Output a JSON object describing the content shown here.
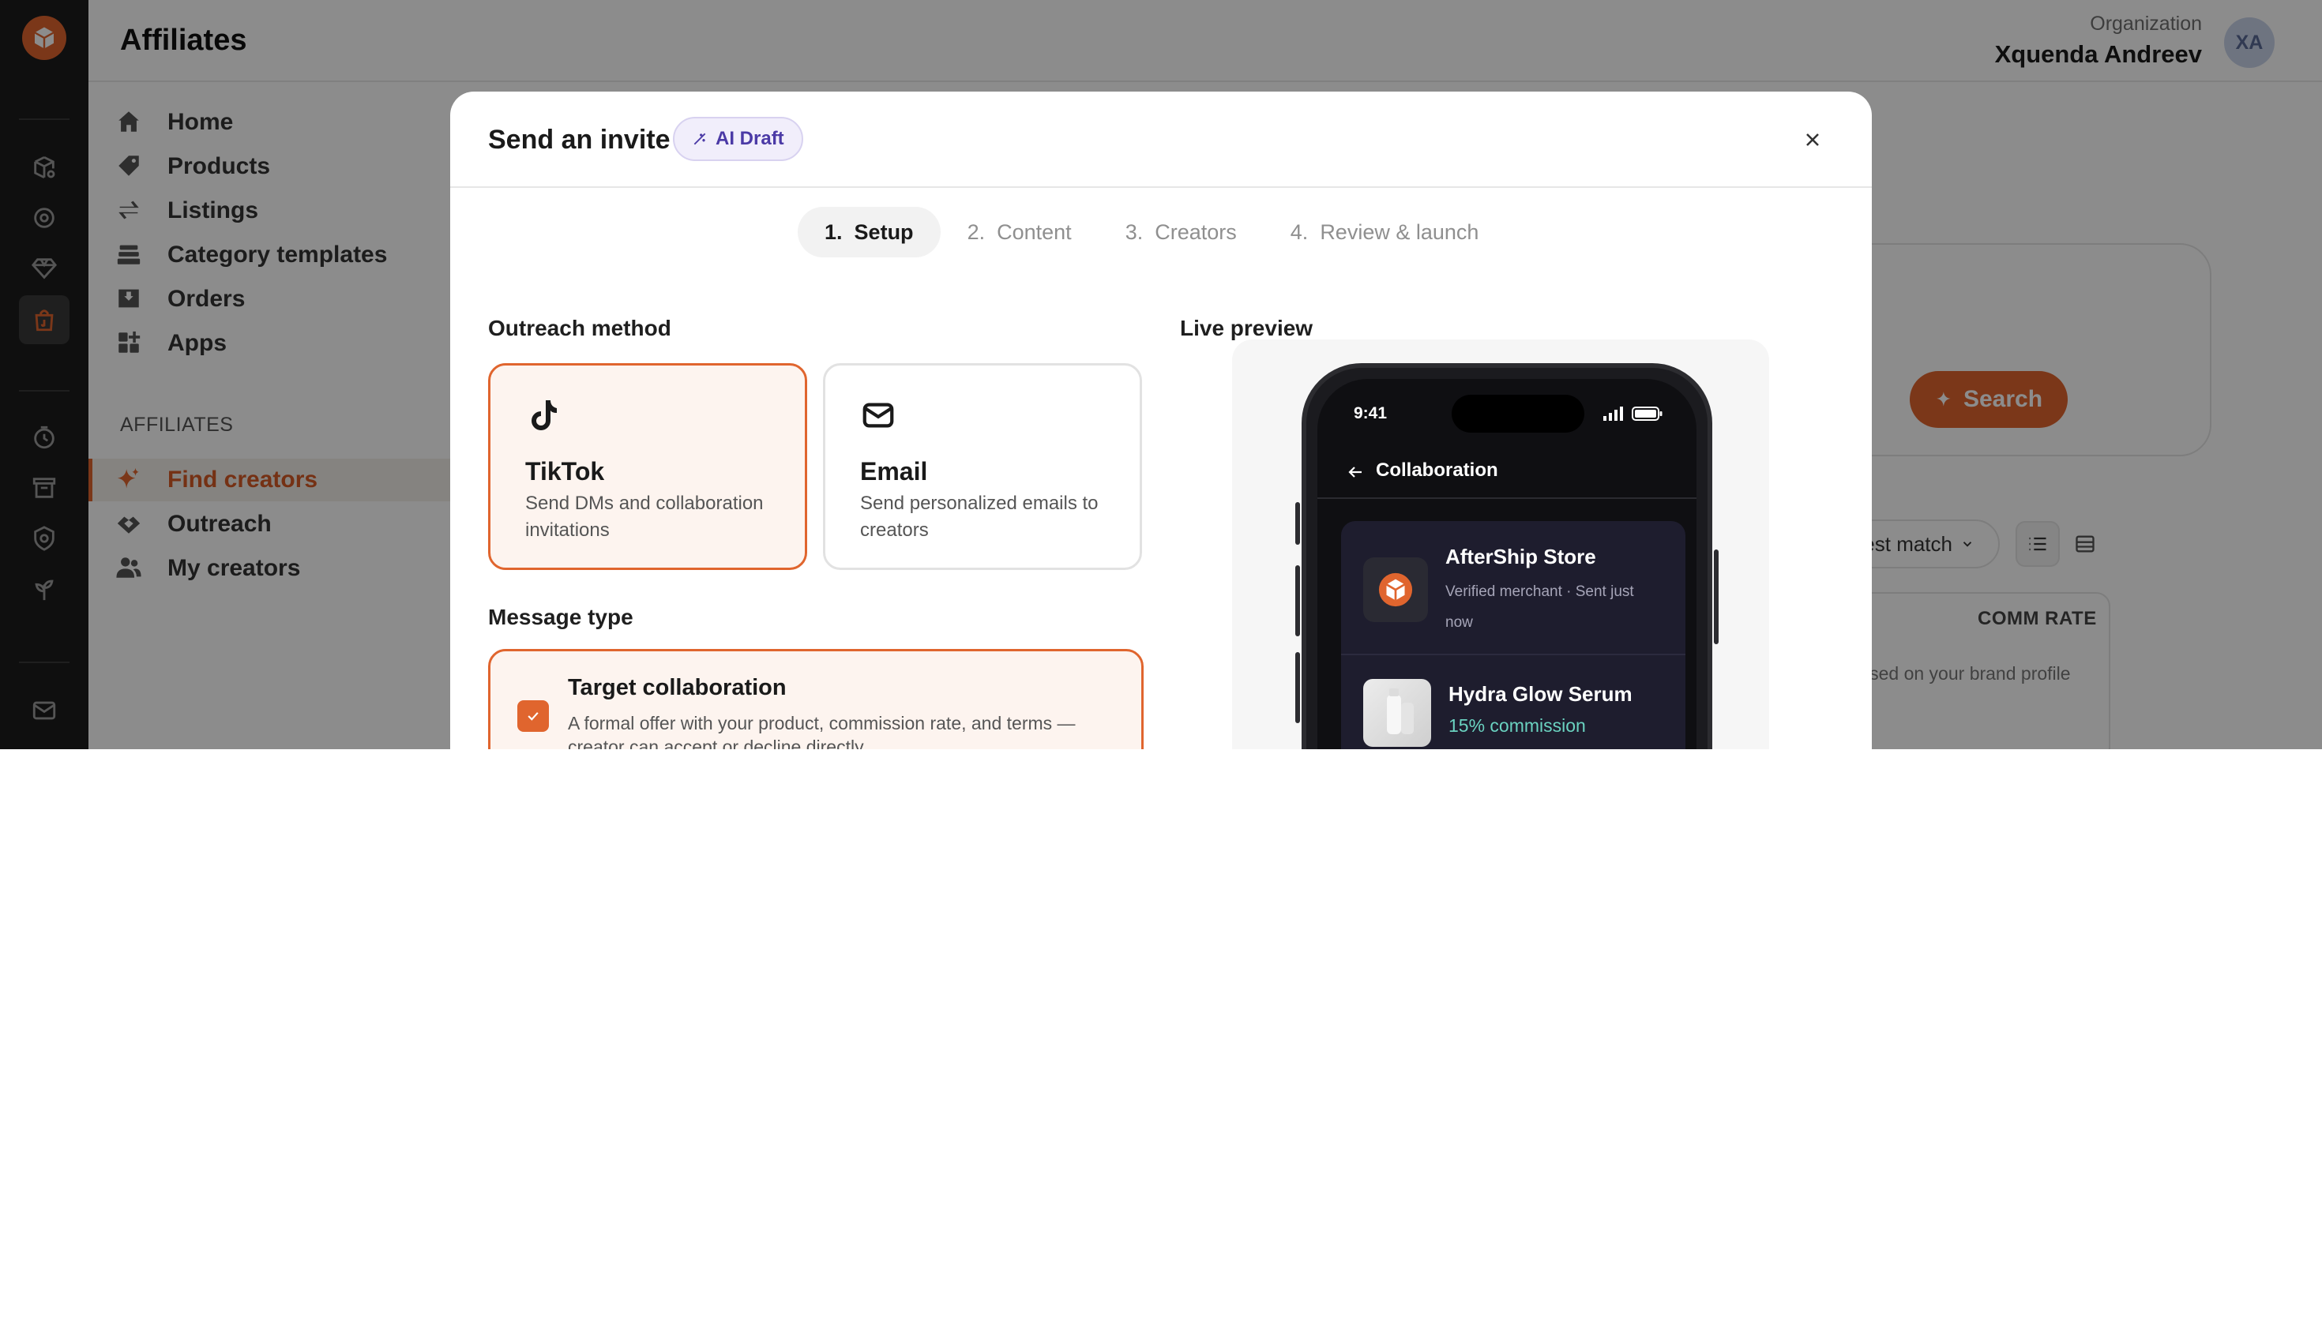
{
  "app": {
    "title": "Affiliates",
    "organization_label": "Organization",
    "organization_name": "Xquenda Andreev",
    "avatar_initials": "XA",
    "accent_color": "#e0652e"
  },
  "nav": {
    "items": [
      {
        "label": "Home",
        "icon": "home-icon"
      },
      {
        "label": "Products",
        "icon": "tag-icon"
      },
      {
        "label": "Listings",
        "icon": "sync-icon"
      },
      {
        "label": "Category templates",
        "icon": "layers-icon"
      },
      {
        "label": "Orders",
        "icon": "inbox-icon"
      },
      {
        "label": "Apps",
        "icon": "apps-icon"
      }
    ],
    "section_label": "AFFILIATES",
    "affiliate_items": [
      {
        "label": "Find creators",
        "icon": "sparkle-icon",
        "active": true
      },
      {
        "label": "Outreach",
        "icon": "handshake-icon",
        "active": false
      },
      {
        "label": "My creators",
        "icon": "users-icon",
        "active": false
      }
    ]
  },
  "background": {
    "search_button": "Search",
    "sort_label": "est match",
    "column_header": "COMM RATE",
    "note": "ised on your brand profile"
  },
  "modal": {
    "title": "Send an invite",
    "badge": "AI Draft",
    "steps": [
      {
        "num": "1.",
        "label": "Setup",
        "active": true
      },
      {
        "num": "2.",
        "label": "Content",
        "active": false
      },
      {
        "num": "3.",
        "label": "Creators",
        "active": false
      },
      {
        "num": "4.",
        "label": "Review & launch",
        "active": false
      }
    ],
    "outreach_label": "Outreach method",
    "methods": [
      {
        "title": "TikTok",
        "description": "Send DMs and collaboration invitations",
        "icon": "tiktok-icon",
        "selected": true
      },
      {
        "title": "Email",
        "description": "Send personalized emails to creators",
        "icon": "mail-icon",
        "selected": false
      }
    ],
    "message_type_label": "Message type",
    "message_option": {
      "title": "Target collaboration",
      "description": "A formal offer with your product, commission rate, and terms — creator can accept or decline directly.",
      "checked": true
    },
    "live_preview_label": "Live preview"
  },
  "phone": {
    "time": "9:41",
    "nav_title": "Collaboration",
    "store_name": "AfterShip Store",
    "store_meta": "Verified merchant · Sent just now",
    "product_name": "Hydra Glow Serum",
    "commission": "15% commission"
  }
}
